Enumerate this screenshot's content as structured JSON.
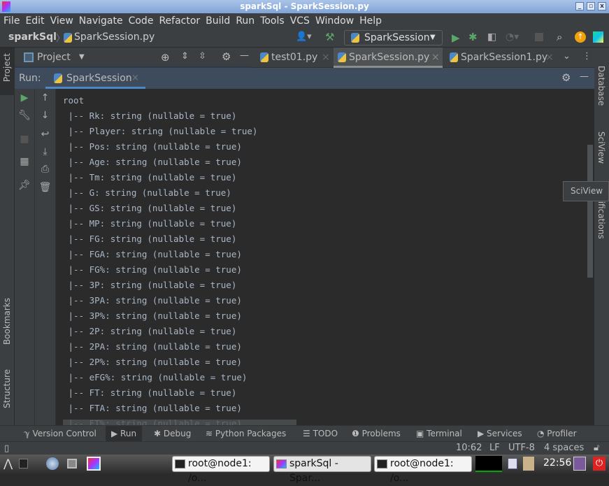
{
  "window": {
    "title": "sparkSql - SparkSession.py"
  },
  "menu": [
    "File",
    "Edit",
    "View",
    "Navigate",
    "Code",
    "Refactor",
    "Build",
    "Run",
    "Tools",
    "VCS",
    "Window",
    "Help"
  ],
  "nav": {
    "project": "sparkSql",
    "file": "SparkSession.py",
    "run_config": "SparkSession"
  },
  "tool_window": {
    "project_label": "Project"
  },
  "editor_tabs": [
    {
      "label": "test01.py",
      "active": false
    },
    {
      "label": "SparkSession.py",
      "active": true
    },
    {
      "label": "SparkSession1.py",
      "active": false
    }
  ],
  "run": {
    "label": "Run:",
    "tab": "SparkSession"
  },
  "console_lines": [
    "root",
    " |-- Rk: string (nullable = true)",
    " |-- Player: string (nullable = true)",
    " |-- Pos: string (nullable = true)",
    " |-- Age: string (nullable = true)",
    " |-- Tm: string (nullable = true)",
    " |-- G: string (nullable = true)",
    " |-- GS: string (nullable = true)",
    " |-- MP: string (nullable = true)",
    " |-- FG: string (nullable = true)",
    " |-- FGA: string (nullable = true)",
    " |-- FG%: string (nullable = true)",
    " |-- 3P: string (nullable = true)",
    " |-- 3PA: string (nullable = true)",
    " |-- 3P%: string (nullable = true)",
    " |-- 2P: string (nullable = true)",
    " |-- 2PA: string (nullable = true)",
    " |-- 2P%: string (nullable = true)",
    " |-- eFG%: string (nullable = true)",
    " |-- FT: string (nullable = true)",
    " |-- FTA: string (nullable = true)",
    " |-- FT%: string (nullable = true)"
  ],
  "left_strip": {
    "project": "Project",
    "bookmarks": "Bookmarks",
    "structure": "Structure"
  },
  "right_strip": {
    "database": "Database",
    "sciview": "SciView",
    "notifications": "tifications"
  },
  "tooltip": "SciView",
  "bottom_tabs": [
    "Version Control",
    "Run",
    "Debug",
    "Python Packages",
    "TODO",
    "Problems",
    "Terminal",
    "Services",
    "Profiler"
  ],
  "status": {
    "position": "10:62",
    "line_sep": "LF",
    "encoding": "UTF-8",
    "indent": "4 spaces"
  },
  "taskbar": {
    "tasks": [
      "root@node1: /o...",
      "sparkSql - Spar...",
      "root@node1: /o..."
    ],
    "clock": "22:56"
  }
}
